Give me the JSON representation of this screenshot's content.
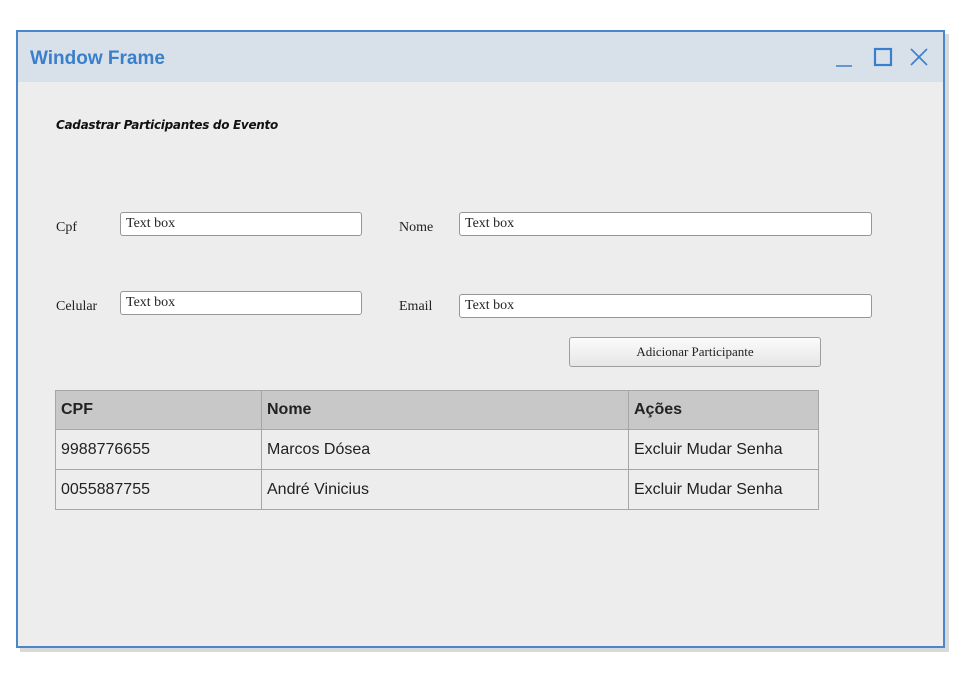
{
  "window": {
    "title": "Window Frame",
    "controls": {
      "minimize": "minimize-icon",
      "maximize": "maximize-icon",
      "close": "close-icon"
    }
  },
  "form": {
    "heading": "Cadastrar Participantes do Evento",
    "cpf_label": "Cpf",
    "cpf_value": "Text box",
    "nome_label": "Nome",
    "nome_value": "Text box",
    "celular_label": "Celular",
    "celular_value": "Text box",
    "email_label": "Email",
    "email_value": "Text box",
    "add_button": "Adicionar Participante"
  },
  "table": {
    "headers": [
      "CPF",
      "Nome",
      "Ações"
    ],
    "rows": [
      {
        "cpf": "9988776655",
        "nome": "Marcos Dósea",
        "acoes": "Excluir Mudar Senha"
      },
      {
        "cpf": "0055887755",
        "nome": "André Vinicius",
        "acoes": "Excluir Mudar Senha"
      }
    ]
  },
  "colors": {
    "accent": "#3a7fcb",
    "border": "#4a86c8",
    "titlebar": "#d8e0ea",
    "background": "#ededed",
    "header_bg": "#c8c8c8"
  }
}
